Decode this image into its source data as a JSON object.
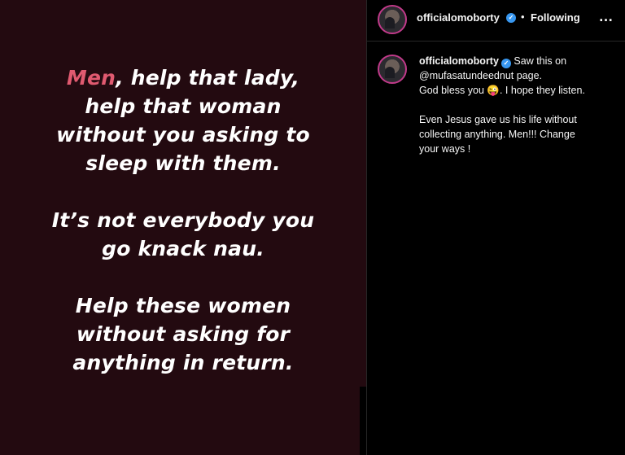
{
  "post": {
    "background_color": "#230a10",
    "accent_color": "#e05a70",
    "paragraphs": [
      {
        "lines": [
          {
            "accent": "Men",
            "text": ", help that lady,"
          },
          {
            "text": "help that woman"
          },
          {
            "text": "without you asking to"
          },
          {
            "text": "sleep with them."
          }
        ]
      },
      {
        "lines": [
          {
            "text": "It’s not everybody you"
          },
          {
            "text": "go knack nau."
          }
        ]
      },
      {
        "lines": [
          {
            "text": "Help these women"
          },
          {
            "text": "without asking for"
          },
          {
            "text": "anything in return."
          }
        ]
      }
    ]
  },
  "header": {
    "username": "officialomoborty",
    "verified_icon": "verified-badge-icon",
    "separator": "•",
    "follow_status": "Following",
    "more_icon": "…"
  },
  "caption": {
    "username": "officialomoborty",
    "first_line": "Saw this on",
    "lines": [
      "@mufasatundeednut page.",
      "God bless you 😜. I hope they listen.",
      "",
      "Even Jesus gave us his life without",
      "collecting anything. Men!!! Change",
      "your ways !"
    ]
  }
}
